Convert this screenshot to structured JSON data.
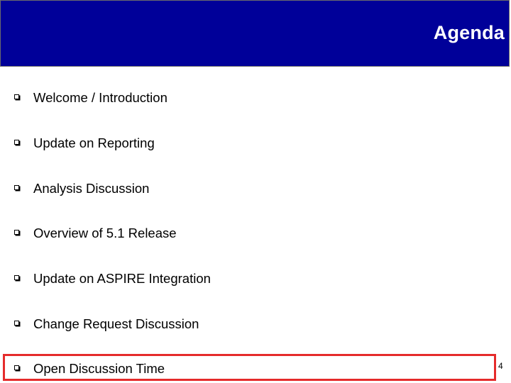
{
  "header": {
    "title": "Agenda"
  },
  "agenda": {
    "items": [
      {
        "label": "Welcome / Introduction"
      },
      {
        "label": "Update on Reporting"
      },
      {
        "label": "Analysis Discussion"
      },
      {
        "label": "Overview of 5.1 Release"
      },
      {
        "label": "Update on ASPIRE Integration"
      },
      {
        "label": "Change Request Discussion"
      },
      {
        "label": "Open Discussion Time"
      }
    ],
    "highlighted_item": "Open Discussion Time"
  },
  "footer": {
    "page_number": "4"
  },
  "colors": {
    "header_bar": "#000099",
    "header_title": "#ffffff",
    "highlight_border": "#e52b2b",
    "body_text": "#000000"
  },
  "icons": {
    "bullet": "hollow-square-bullet-icon"
  }
}
